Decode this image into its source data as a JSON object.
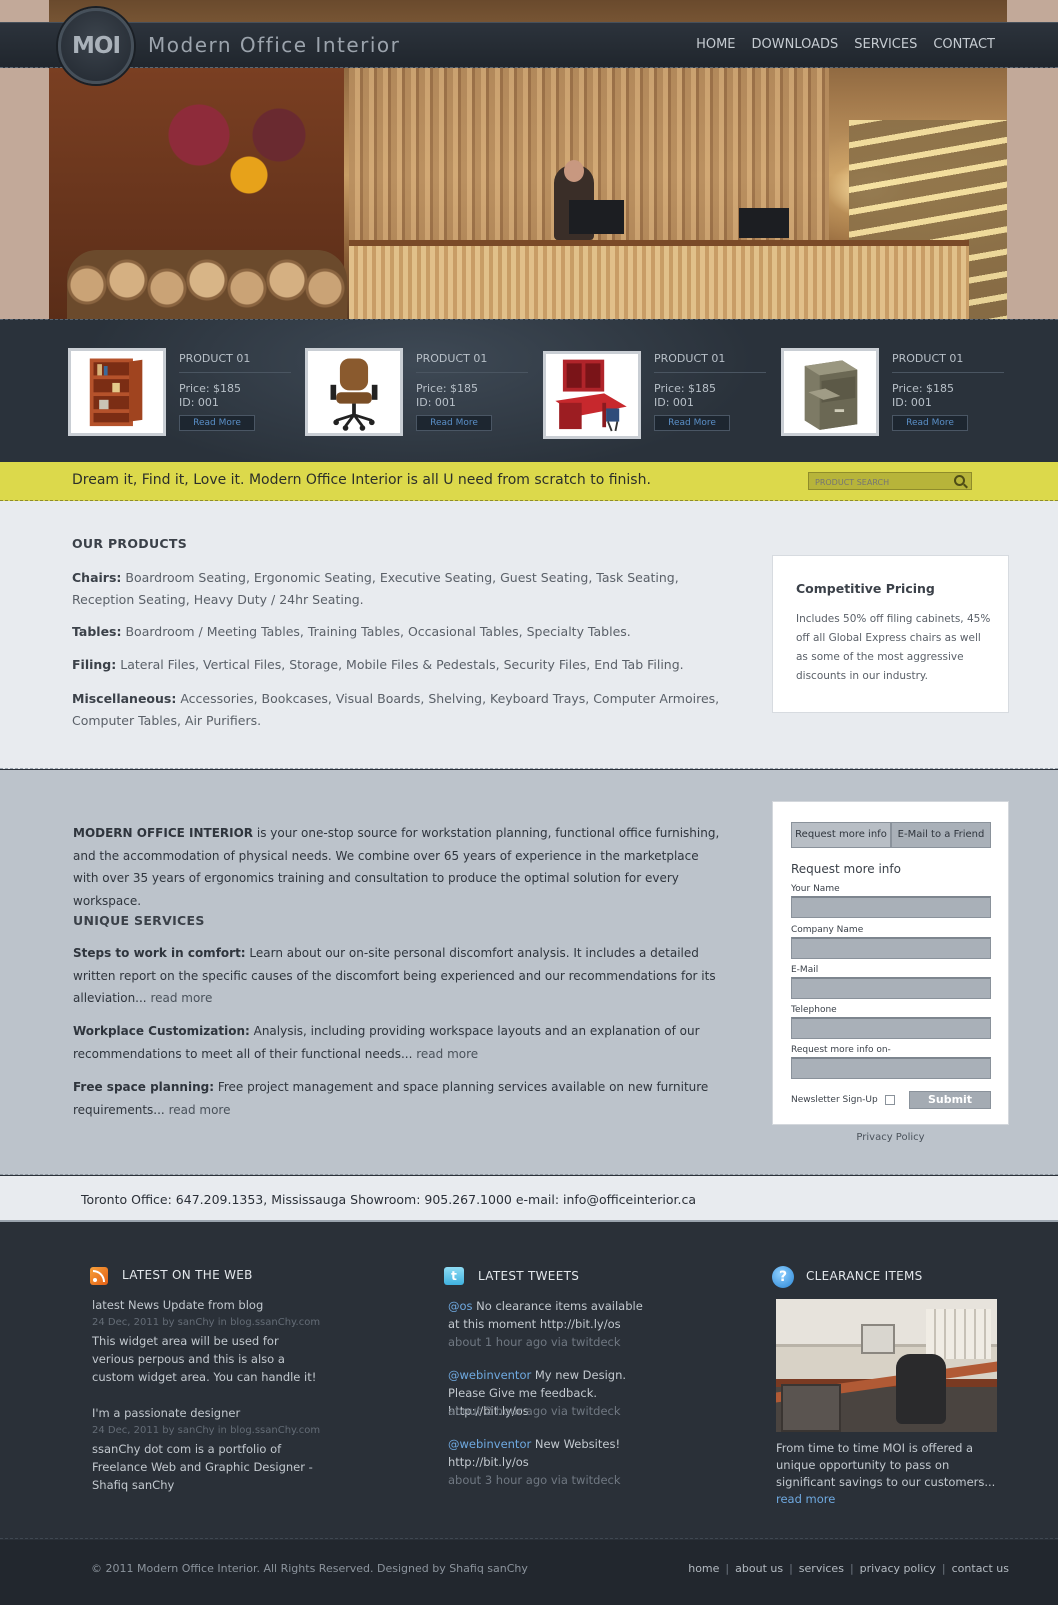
{
  "header": {
    "logo": "MOI",
    "site_name": "Modern Office Interior",
    "nav": [
      "HOME",
      "DOWNLOADS",
      "SERVICES",
      "CONTACT"
    ]
  },
  "products": [
    {
      "title": "PRODUCT 01",
      "price": "Price: $185",
      "id": "ID: 001",
      "button": "Read More",
      "image": "bookcase-image"
    },
    {
      "title": "PRODUCT 01",
      "price": "Price: $185",
      "id": "ID: 001",
      "button": "Read More",
      "image": "office-chair-image"
    },
    {
      "title": "PRODUCT 01",
      "price": "Price: $185",
      "id": "ID: 001",
      "button": "Read More",
      "image": "desk-hutch-image"
    },
    {
      "title": "PRODUCT 01",
      "price": "Price: $185",
      "id": "ID: 001",
      "button": "Read More",
      "image": "filing-cabinet-image"
    }
  ],
  "tagline": {
    "text": "Dream it, Find it, Love it. Modern Office Interior is all U need from scratch to finish.",
    "search_placeholder": "PRODUCT SEARCH"
  },
  "our_products": {
    "heading": "OUR PRODUCTS",
    "lines": [
      {
        "label": "Chairs:",
        "text": " Boardroom Seating, Ergonomic Seating, Executive Seating, Guest Seating, Task Seating, Reception Seating, Heavy Duty / 24hr Seating."
      },
      {
        "label": "Tables:",
        "text": " Boardroom / Meeting Tables, Training Tables, Occasional Tables, Specialty Tables."
      },
      {
        "label": "Filing:",
        "text": " Lateral Files, Vertical Files, Storage, Mobile Files & Pedestals, Security Files, End Tab Filing."
      },
      {
        "label": "Miscellaneous:",
        "text": " Accessories, Bookcases, Visual Boards, Shelving, Keyboard Trays, Computer Armoires, Computer Tables, Air Purifiers."
      }
    ],
    "pricing_title": "Competitive Pricing",
    "pricing_text": "Includes 50% off filing cabinets, 45% off all Global Express chairs as well as some of the most aggressive discounts in our industry."
  },
  "about": {
    "brand": "MODERN OFFICE INTERIOR",
    "text": " is your one-stop source for workstation planning, functional office furnishing, and the accommodation of physical needs. We combine over 65 years of experience in the marketplace with over 35 years of ergonomics training and consultation to produce the optimal solution for every workspace.",
    "services_heading": "UNIQUE SERVICES",
    "services": [
      {
        "label": "Steps to work in comfort:",
        "text": " Learn about our on-site personal discomfort analysis. It includes a detailed written report on the specific causes of the discomfort being experienced and our recommendations for its alleviation...",
        "link": " read more"
      },
      {
        "label": "Workplace Customization:",
        "text": " Analysis, including providing workspace layouts and an explanation of our recommendations to meet all of their functional needs...",
        "link": " read more"
      },
      {
        "label": "Free space planning:",
        "text": " Free project management and space planning services available on new furniture requirements...",
        "link": " read more"
      }
    ]
  },
  "form": {
    "tabs": [
      "Request more info",
      "E-Mail to a Friend"
    ],
    "heading": "Request more info",
    "fields": [
      "Your Name",
      "Company Name",
      "E-Mail",
      "Telephone",
      "Request more info on-"
    ],
    "newsletter": "Newsletter  Sign-Up",
    "submit": "Submit",
    "privacy": "Privacy Policy"
  },
  "contact": {
    "text": "Toronto Office: 647.209.1353, Mississauga Showroom: 905.267.1000 e-mail: info@officeinterior.ca"
  },
  "footer": {
    "web_title": "LATEST ON THE WEB",
    "web_items": [
      {
        "title": "latest News Update from blog",
        "meta": "24 Dec, 2011 by sanChy in blog.ssanChy.com",
        "text": "This widget area will be used for verious perpous and this is also a custom widget area. You can handle it!"
      },
      {
        "title": "I'm a passionate designer",
        "meta": "24 Dec, 2011 by sanChy in blog.ssanChy.com",
        "text": "ssanChy dot com is a portfolio of Freelance Web and Graphic Designer -Shafiq sanChy"
      }
    ],
    "tweets_title": "LATEST TWEETS",
    "tweets": [
      {
        "user": "@os",
        "text": " No clearance items available at this moment ",
        "link": "http://bit.ly/os",
        "meta": "about 1 hour ago via twitdeck"
      },
      {
        "user": "@webinventor",
        "text": " My new Design. Please Give me feedback. ",
        "link": "http://bit.ly/os",
        "meta": "about 2 hour ago via twitdeck"
      },
      {
        "user": "@webinventor",
        "text": " New Websites! ",
        "link": "http://bit.ly/os",
        "meta": "about 3 hour ago via twitdeck"
      }
    ],
    "clearance_title": "CLEARANCE ITEMS",
    "clearance_text": "From time to time MOI is offered a unique opportunity to pass on significant savings to our customers...",
    "clearance_link": " read more",
    "copyright": "© 2011 Modern Office Interior. All Rights Reserved. Designed by Shafiq sanChy",
    "links": [
      "home",
      "about us",
      "services",
      "privacy policy",
      "contact us"
    ]
  }
}
